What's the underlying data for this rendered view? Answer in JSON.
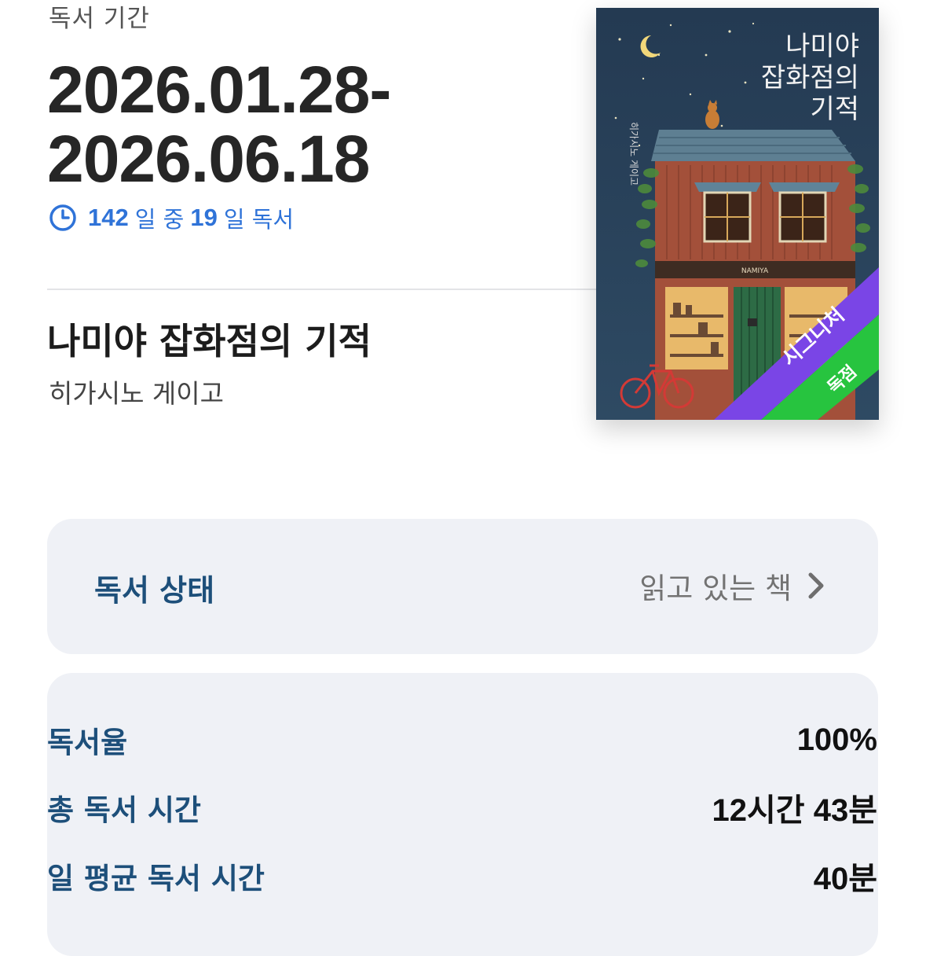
{
  "period": {
    "label": "독서 기간",
    "start": "2026.01.28-",
    "end": "2026.06.18"
  },
  "progress": {
    "total_days": "142",
    "total_suffix": "일 중",
    "read_days": "19",
    "read_suffix": "일 독서",
    "icon": "clock-icon",
    "color": "#2f73d8"
  },
  "book": {
    "title": "나미야 잡화점의 기적",
    "author": "히가시노 게이고"
  },
  "cover": {
    "title_line1": "나미야",
    "title_line2": "잡화점의",
    "title_line3": "기적",
    "author_vertical": "히가시노 게이고",
    "shop_sign": "NAMIYA",
    "badge_top": "시그니처",
    "badge_bottom": "독점",
    "badge_top_color": "#7a45e6",
    "badge_bottom_color": "#27c43f"
  },
  "status": {
    "label": "독서 상태",
    "value": "읽고 있는 책"
  },
  "stats": [
    {
      "label": "독서율",
      "value": "100%"
    },
    {
      "label": "총 독서 시간",
      "value": "12시간 43분"
    },
    {
      "label": "일 평균 독서 시간",
      "value": "40분"
    }
  ]
}
